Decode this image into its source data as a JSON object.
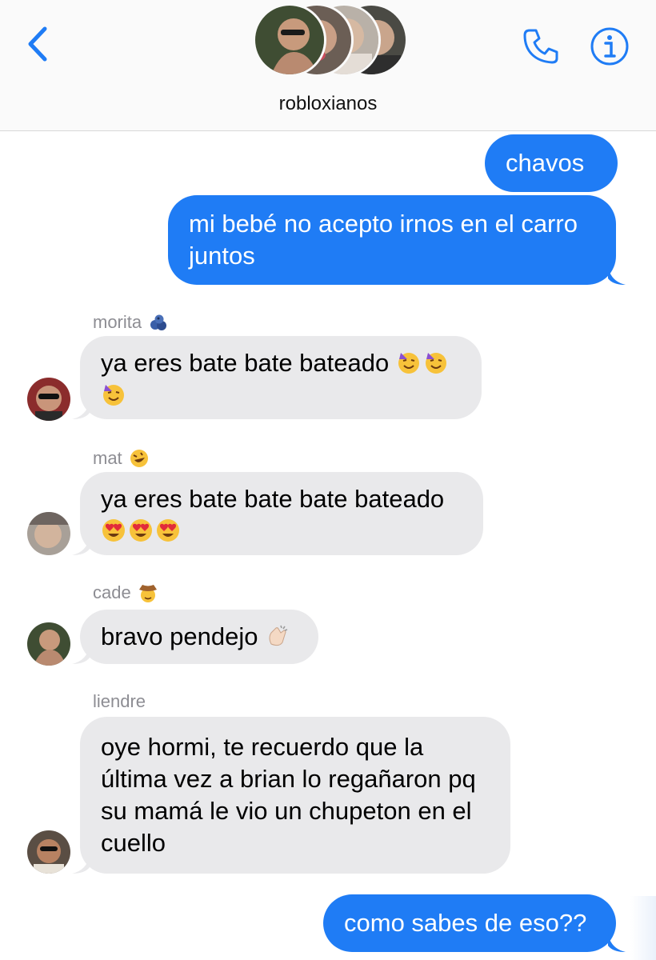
{
  "header": {
    "group_name": "robloxianos",
    "icons": [
      "chevron-left-icon",
      "phone-icon",
      "info-icon"
    ],
    "accent_color": "#1f7cf5"
  },
  "messages": [
    {
      "side": "out",
      "text": "chavos"
    },
    {
      "side": "out",
      "lines": [
        "mi bebé no acepto irnos en el carro",
        "juntos"
      ]
    },
    {
      "side": "in",
      "sender": "morita",
      "sender_emoji": "blueberries-icon",
      "lines": [
        "ya eres bate bate bateado"
      ],
      "emoji": [
        "partying-face-icon",
        "partying-face-icon",
        "partying-face-icon"
      ]
    },
    {
      "side": "in",
      "sender": "mat",
      "sender_emoji": "rolling-laughing-icon",
      "lines": [
        "ya eres bate bate bate bateado"
      ],
      "emoji": [
        "heart-eyes-icon",
        "heart-eyes-icon",
        "heart-eyes-icon"
      ]
    },
    {
      "side": "in",
      "sender": "cade",
      "sender_emoji": "cowboy-face-icon",
      "lines": [
        "bravo pendejo"
      ],
      "emoji": [
        "clapping-hands-icon"
      ]
    },
    {
      "side": "in",
      "sender": "liendre",
      "lines": [
        "oye hormi, te recuerdo que la",
        "última vez a brian lo regañaron pq",
        "su mamá le vio un chupeton en el",
        "cuello"
      ]
    },
    {
      "side": "out",
      "text": "como sabes de eso??"
    }
  ],
  "colors": {
    "outgoing_bubble": "#1f7cf5",
    "incoming_bubble": "#e9e9eb",
    "sender_name": "#8d8d93"
  }
}
